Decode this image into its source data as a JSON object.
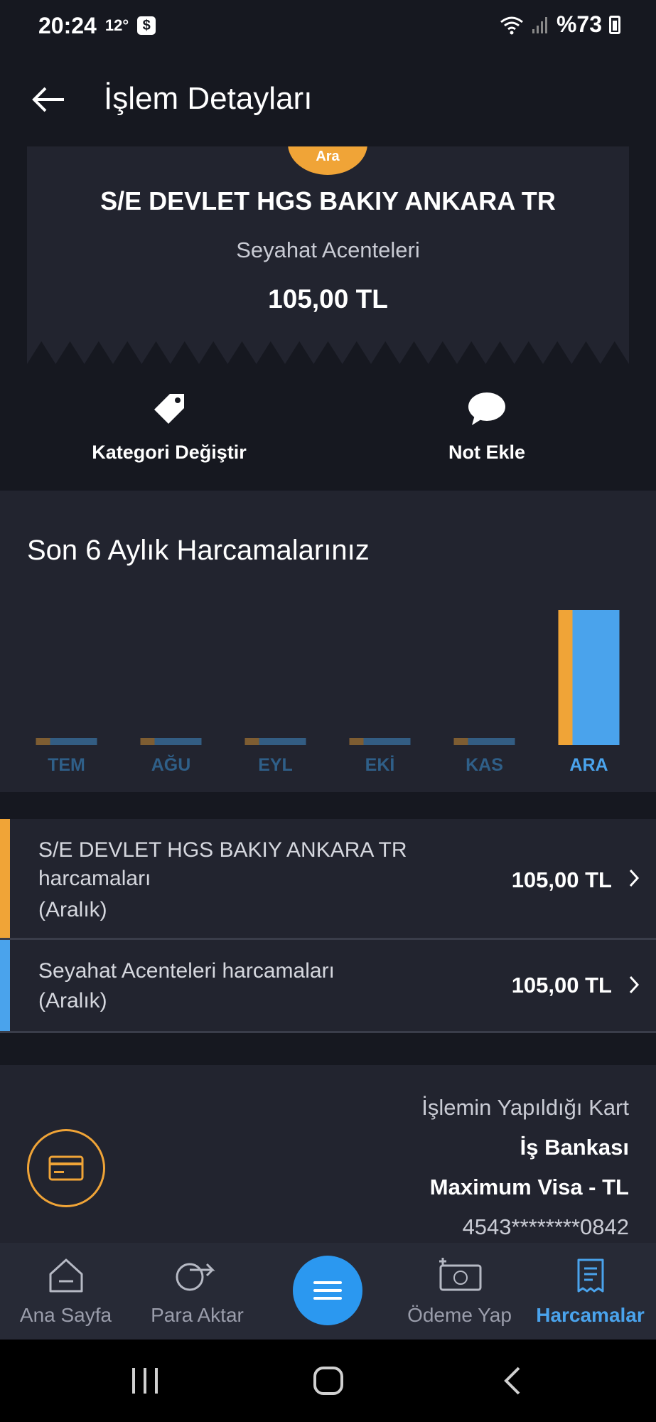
{
  "status": {
    "time": "20:24",
    "temp": "12°",
    "battery": "%73"
  },
  "header": {
    "title": "İşlem Detayları"
  },
  "transaction": {
    "badge": "Ara",
    "merchant": "S/E DEVLET HGS BAKIY ANKARA TR",
    "category": "Seyahat Acenteleri",
    "amount": "105,00 TL"
  },
  "actions": {
    "change_category": "Kategori Değiştir",
    "add_note": "Not Ekle"
  },
  "chart_section": {
    "title": "Son 6 Aylık Harcamalarınız"
  },
  "chart_data": {
    "type": "bar",
    "categories": [
      "TEM",
      "AĞU",
      "EYL",
      "EKİ",
      "KAS",
      "ARA"
    ],
    "series": [
      {
        "values": [
          0,
          0,
          0,
          0,
          0,
          105
        ]
      },
      {
        "values": [
          0,
          0,
          0,
          0,
          0,
          105
        ]
      }
    ],
    "highlighted_category": "ARA",
    "colors": [
      "#f0a437",
      "#4aa3ec"
    ],
    "ylim": [
      0,
      105
    ]
  },
  "spending": [
    {
      "line1": "S/E DEVLET HGS BAKIY    ANKARA      TR",
      "line2": "harcamaları",
      "line3": "(Aralık)",
      "amount": "105,00 TL",
      "color": "#f0a437"
    },
    {
      "line1": "Seyahat Acenteleri harcamaları",
      "line2": "(Aralık)",
      "amount": "105,00 TL",
      "color": "#4aa3ec"
    }
  ],
  "card": {
    "label": "İşlemin Yapıldığı Kart",
    "bank": "İş Bankası",
    "product": "Maximum Visa - TL",
    "number": "4543********0842"
  },
  "nav": {
    "home": "Ana Sayfa",
    "transfer": "Para Aktar",
    "pay": "Ödeme Yap",
    "spending": "Harcamalar"
  }
}
